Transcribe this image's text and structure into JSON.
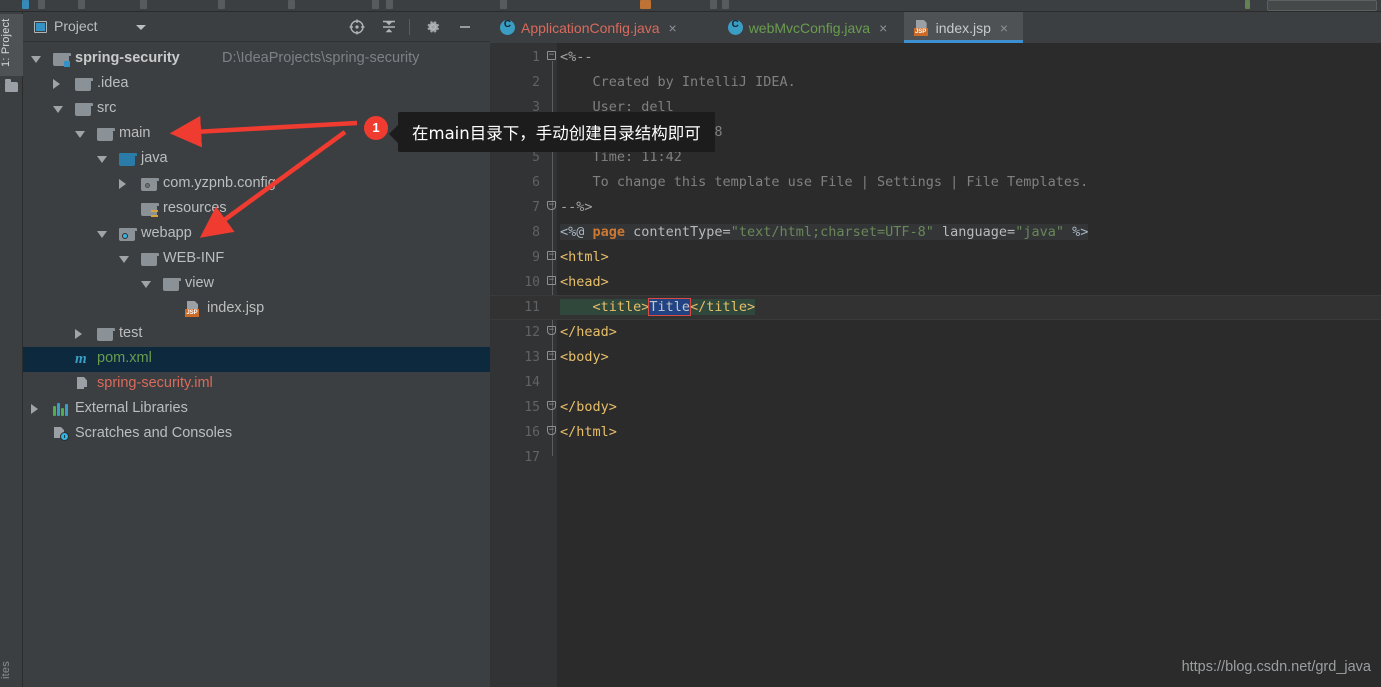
{
  "window": {
    "tool_window_left_top": "1: Project",
    "tool_window_left_bottom": "ites",
    "watermark": "https://blog.csdn.net/grd_java"
  },
  "project_panel": {
    "title": "Project",
    "icons": {
      "locate": "crosshair-target-icon",
      "collapse_all": "collapse-all-icon",
      "settings": "gear-icon",
      "hide": "minimize-icon"
    },
    "tree": [
      {
        "label": "spring-security",
        "path": "D:\\IdeaProjects\\spring-security",
        "icon": "module-folder-icon",
        "indent": 0,
        "arrow": "expanded",
        "style": "bold"
      },
      {
        "label": ".idea",
        "path": "",
        "icon": "folder-icon",
        "indent": 1,
        "arrow": "collapsed",
        "style": "normal"
      },
      {
        "label": "src",
        "path": "",
        "icon": "folder-icon",
        "indent": 1,
        "arrow": "expanded",
        "style": "normal"
      },
      {
        "label": "main",
        "path": "",
        "icon": "folder-icon",
        "indent": 2,
        "arrow": "expanded",
        "style": "normal"
      },
      {
        "label": "java",
        "path": "",
        "icon": "source-root-folder-icon",
        "indent": 3,
        "arrow": "expanded",
        "style": "normal"
      },
      {
        "label": "com.yzpnb.config",
        "path": "",
        "icon": "package-icon",
        "indent": 4,
        "arrow": "collapsed",
        "style": "normal"
      },
      {
        "label": "resources",
        "path": "",
        "icon": "resources-folder-icon",
        "indent": 4,
        "arrow": "none",
        "style": "normal"
      },
      {
        "label": "webapp",
        "path": "",
        "icon": "web-folder-icon",
        "indent": 3,
        "arrow": "expanded",
        "style": "normal"
      },
      {
        "label": "WEB-INF",
        "path": "",
        "icon": "folder-icon",
        "indent": 4,
        "arrow": "expanded",
        "style": "normal"
      },
      {
        "label": "view",
        "path": "",
        "icon": "folder-icon",
        "indent": 5,
        "arrow": "expanded",
        "style": "normal"
      },
      {
        "label": "index.jsp",
        "path": "",
        "icon": "jsp-file-icon",
        "indent": 6,
        "arrow": "none",
        "style": "normal"
      },
      {
        "label": "test",
        "path": "",
        "icon": "folder-icon",
        "indent": 2,
        "arrow": "collapsed",
        "style": "normal"
      },
      {
        "label": "pom.xml",
        "path": "",
        "icon": "maven-file-icon",
        "indent": 1,
        "arrow": "none",
        "style": "green",
        "selected": true
      },
      {
        "label": "spring-security.iml",
        "path": "",
        "icon": "iml-file-icon",
        "indent": 1,
        "arrow": "none",
        "style": "red"
      },
      {
        "label": "External Libraries",
        "path": "",
        "icon": "libraries-icon",
        "indent": 0,
        "arrow": "collapsed",
        "style": "normal"
      },
      {
        "label": "Scratches and Consoles",
        "path": "",
        "icon": "scratches-icon",
        "indent": 0,
        "arrow": "none",
        "style": "normal"
      }
    ]
  },
  "editor": {
    "tabs": [
      {
        "label": "ApplicationConfig.java",
        "icon": "java-class-icon",
        "color": "#d96a5c",
        "active": false,
        "close": "×"
      },
      {
        "label": "webMvcConfig.java",
        "icon": "java-class-icon",
        "color": "#6a9c4f",
        "active": false,
        "close": "×"
      },
      {
        "label": "index.jsp",
        "icon": "jsp-file-icon",
        "color": "#c8cacc",
        "active": true,
        "close": "×"
      }
    ],
    "line_numbers": [
      "1",
      "2",
      "3",
      "4",
      "5",
      "6",
      "7",
      "8",
      "9",
      "10",
      "11",
      "12",
      "13",
      "14",
      "15",
      "16",
      "17"
    ],
    "lines": [
      {
        "n": "1",
        "segs": [
          {
            "t": "<%--",
            "c": "c-comment-b"
          }
        ]
      },
      {
        "n": "2",
        "segs": [
          {
            "t": "    Created by IntelliJ IDEA.",
            "c": "c-comment"
          }
        ]
      },
      {
        "n": "3",
        "segs": [
          {
            "t": "    User: dell",
            "c": "c-comment"
          }
        ]
      },
      {
        "n": "4",
        "segs": [
          {
            "t": "    Date: 2020/12/18",
            "c": "c-comment"
          }
        ]
      },
      {
        "n": "5",
        "segs": [
          {
            "t": "    Time: 11:42",
            "c": "c-comment"
          }
        ]
      },
      {
        "n": "6",
        "segs": [
          {
            "t": "    To change this template use File | Settings | File Templates.",
            "c": "c-comment"
          }
        ]
      },
      {
        "n": "7",
        "segs": [
          {
            "t": "--%>",
            "c": "c-comment-b"
          }
        ]
      },
      {
        "n": "8",
        "segs": [
          {
            "t": "<%@ ",
            "c": "c-jsp"
          },
          {
            "t": "page ",
            "c": "c-kw"
          },
          {
            "t": "contentType=",
            "c": "c-attr"
          },
          {
            "t": "\"text/html;charset=UTF-8\"",
            "c": "c-str"
          },
          {
            "t": " language=",
            "c": "c-attr"
          },
          {
            "t": "\"java\"",
            "c": "c-str"
          },
          {
            "t": " %>",
            "c": "c-jsp"
          }
        ]
      },
      {
        "n": "9",
        "segs": [
          {
            "t": "<html>",
            "c": "c-tag"
          }
        ]
      },
      {
        "n": "10",
        "segs": [
          {
            "t": "<head>",
            "c": "c-tag"
          }
        ]
      },
      {
        "n": "11",
        "segs": [
          {
            "t": "    <title>",
            "c": "c-tag"
          },
          {
            "t": "Title",
            "c": "sel"
          },
          {
            "t": "</title>",
            "c": "c-tag"
          }
        ]
      },
      {
        "n": "12",
        "segs": [
          {
            "t": "</head>",
            "c": "c-tag"
          }
        ]
      },
      {
        "n": "13",
        "segs": [
          {
            "t": "<body>",
            "c": "c-tag"
          }
        ]
      },
      {
        "n": "14",
        "segs": [
          {
            "t": "",
            "c": "c-tag"
          }
        ]
      },
      {
        "n": "15",
        "segs": [
          {
            "t": "</body>",
            "c": "c-tag"
          }
        ]
      },
      {
        "n": "16",
        "segs": [
          {
            "t": "</html>",
            "c": "c-tag"
          }
        ]
      },
      {
        "n": "17",
        "segs": [
          {
            "t": "",
            "c": "c-tag"
          }
        ]
      }
    ],
    "selected_text": "Title",
    "caret_line": "11"
  },
  "annotation": {
    "badge": "1",
    "text": "在main目录下，手动创建目录结构即可",
    "arrow_targets": [
      "main",
      "webapp"
    ],
    "color": "#ef3b30"
  }
}
